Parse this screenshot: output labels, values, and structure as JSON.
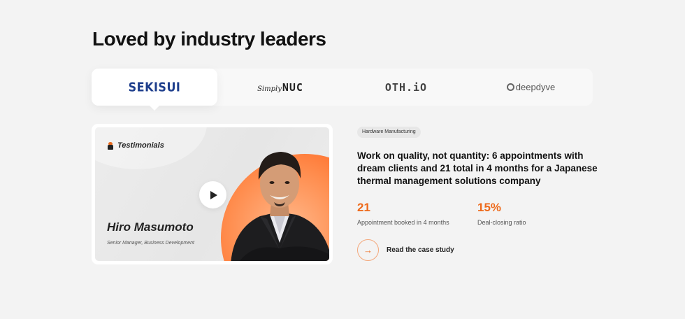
{
  "section": {
    "title": "Loved by industry leaders"
  },
  "logos": [
    {
      "text": "SEKISUI",
      "active": true
    },
    {
      "script": "Simply",
      "mark": "NUC",
      "active": false
    },
    {
      "text": "OTH.iO",
      "active": false
    },
    {
      "text": "deepdyve",
      "active": false
    }
  ],
  "video": {
    "label": "Testimonials",
    "person_name": "Hiro Masumoto",
    "person_role": "Senior Manager, Business Development",
    "play_icon": "play-icon"
  },
  "case": {
    "tag": "Hardware Manufacturing",
    "headline": "Work on quality, not quantity: 6 appointments with dream clients and 21 total in 4 months for a Japanese thermal management solutions company",
    "stats": [
      {
        "value": "21",
        "label": "Appointment booked in 4 months"
      },
      {
        "value": "15%",
        "label": "Deal-closing ratio"
      }
    ],
    "cta_label": "Read the case study",
    "cta_icon": "arrow-right-icon"
  },
  "colors": {
    "accent": "#ee6a1b",
    "brand_blue": "#1e3e8c",
    "background": "#f3f3f3"
  }
}
